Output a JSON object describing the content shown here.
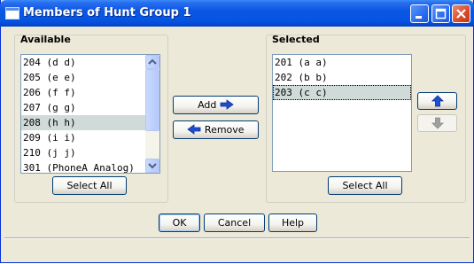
{
  "window": {
    "title": "Members of Hunt Group 1"
  },
  "available": {
    "label": "Available",
    "items": [
      "204 (d d)",
      "205 (e e)",
      "206 (f f)",
      "207 (g g)",
      "208 (h h)",
      "209 (i i)",
      "210 (j j)",
      "301 (PhoneA Analog)"
    ],
    "selected_index": 4,
    "select_all_label": "Select All"
  },
  "selected": {
    "label": "Selected",
    "items": [
      "201 (a a)",
      "202 (b b)",
      "203 (c c)"
    ],
    "selected_index": 2,
    "select_all_label": "Select All"
  },
  "transfer": {
    "add_label": "Add",
    "remove_label": "Remove"
  },
  "footer": {
    "ok_label": "OK",
    "cancel_label": "Cancel",
    "help_label": "Help"
  },
  "icons": {
    "add": "arrow-right-icon",
    "remove": "arrow-left-icon",
    "move_up": "arrow-up-icon",
    "move_down": "arrow-down-icon"
  },
  "colors": {
    "title_bar": "#0a57e3",
    "selection": "#cfdad9",
    "arrow_blue": "#1c4fd1"
  }
}
